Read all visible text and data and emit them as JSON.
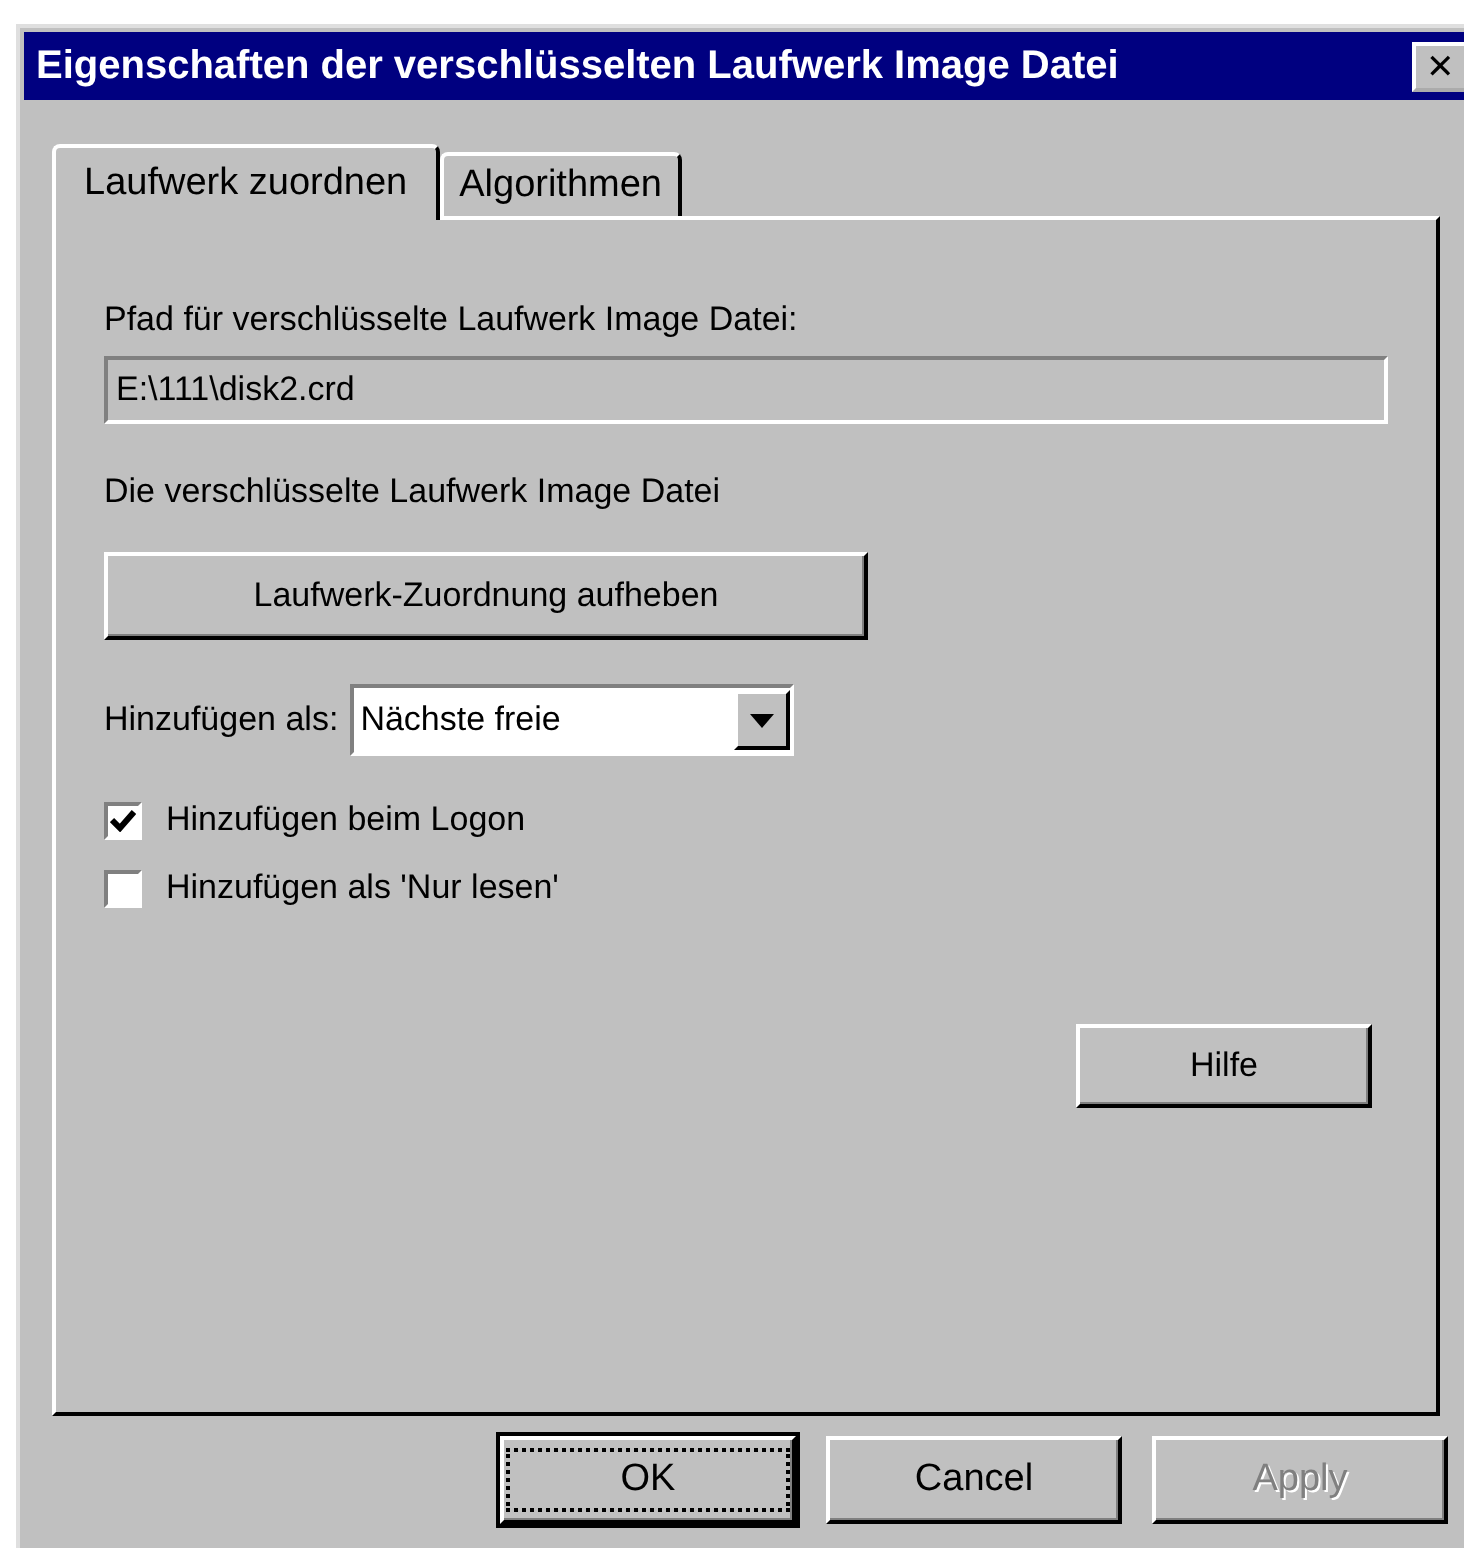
{
  "window": {
    "title": "Eigenschaften der verschlüsselten Laufwerk Image Datei",
    "close": "✕"
  },
  "tabs": [
    {
      "label": "Laufwerk zuordnen",
      "selected": true
    },
    {
      "label": "Algorithmen",
      "selected": false
    }
  ],
  "path": {
    "label": "Pfad für verschlüsselte Laufwerk Image Datei:",
    "value": "E:\\111\\disk2.crd"
  },
  "status_text": "Die verschlüsselte Laufwerk Image Datei",
  "unmap_button": "Laufwerk-Zuordnung aufheben",
  "add_as": {
    "label": "Hinzufügen als:",
    "value": "Nächste freie"
  },
  "checkboxes": [
    {
      "label": "Hinzufügen beim Logon",
      "checked": true
    },
    {
      "label": "Hinzufügen als 'Nur lesen'",
      "checked": false
    }
  ],
  "help_button": "Hilfe",
  "buttons": [
    {
      "label": "OK",
      "disabled": false,
      "focused": true
    },
    {
      "label": "Cancel",
      "disabled": false,
      "focused": false
    },
    {
      "label": "Apply",
      "disabled": true,
      "focused": false
    }
  ]
}
